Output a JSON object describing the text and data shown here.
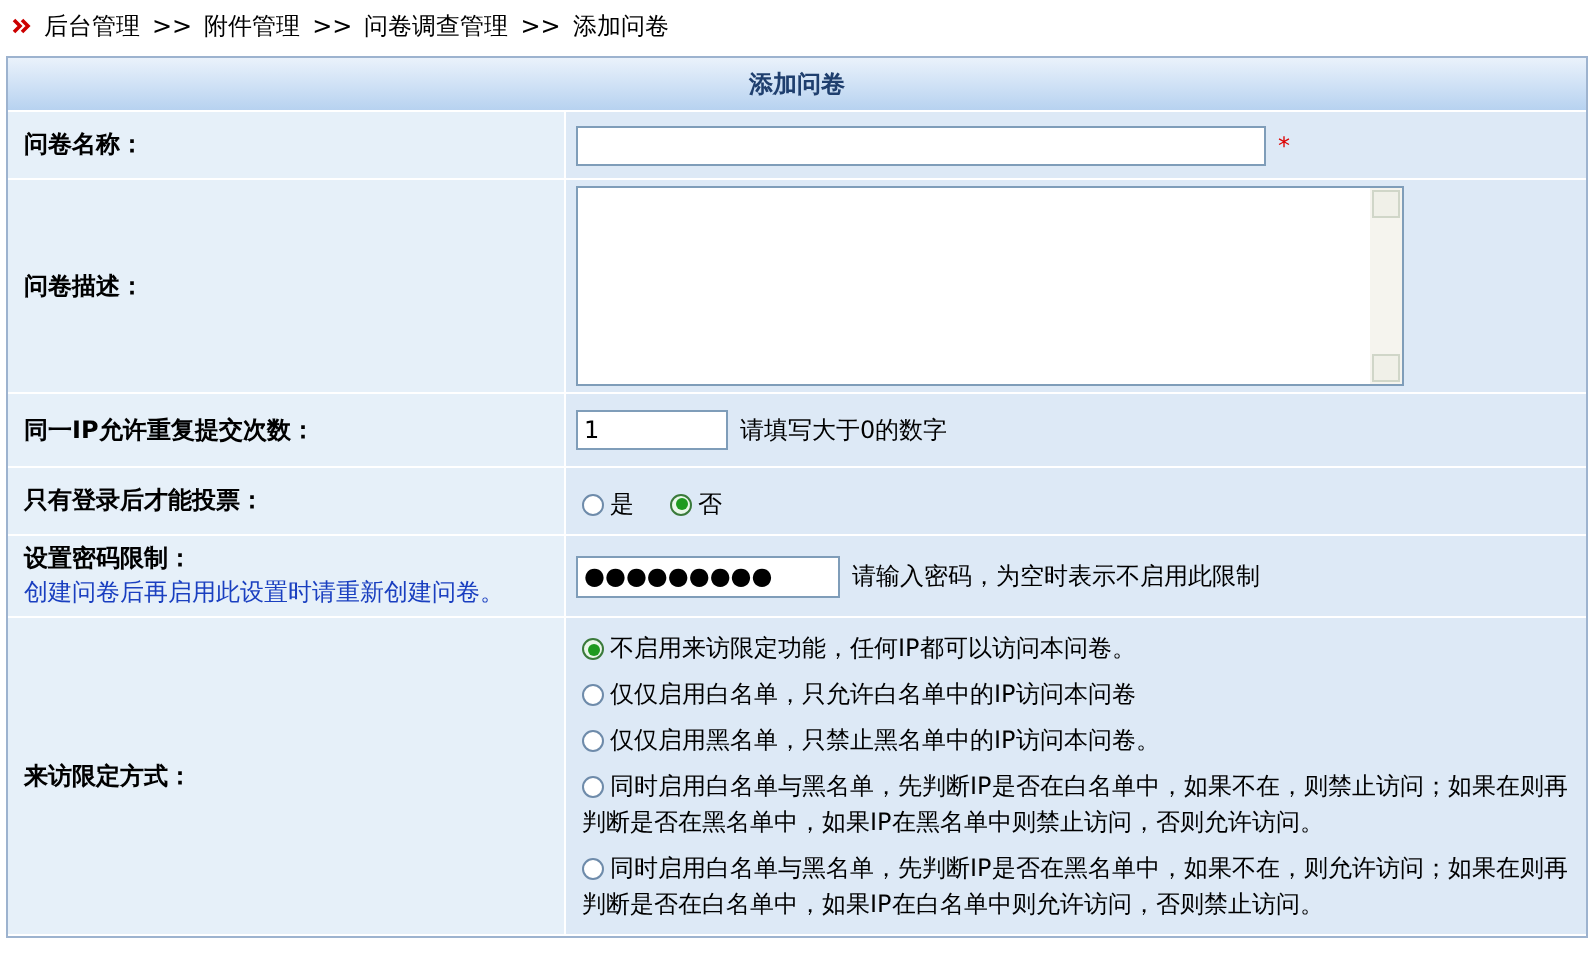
{
  "breadcrumb": {
    "items": [
      "后台管理",
      "附件管理",
      "问卷调查管理",
      "添加问卷"
    ],
    "separator": ">>"
  },
  "form": {
    "title": "添加问卷",
    "rows": [
      {
        "kind": "text",
        "label": "问卷名称：",
        "value": "",
        "required_mark": "*"
      },
      {
        "kind": "textarea",
        "label": "问卷描述：",
        "value": ""
      },
      {
        "kind": "text_hint",
        "label": "同一IP允许重复提交次数：",
        "value": "1",
        "hint": "请填写大于0的数字"
      },
      {
        "kind": "radio_inline",
        "label": "只有登录后才能投票：",
        "options": [
          {
            "label": "是",
            "selected": false
          },
          {
            "label": "否",
            "selected": true
          }
        ]
      },
      {
        "kind": "password",
        "label": "设置密码限制：",
        "note": "创建问卷后再启用此设置时请重新创建问卷。",
        "value": "●●●●●●●●●",
        "hint": "请输入密码，为空时表示不启用此限制"
      },
      {
        "kind": "radio_list",
        "label": "来访限定方式：",
        "options": [
          {
            "label": "不启用来访限定功能，任何IP都可以访问本问卷。",
            "selected": true
          },
          {
            "label": "仅仅启用白名单，只允许白名单中的IP访问本问卷",
            "selected": false
          },
          {
            "label": "仅仅启用黑名单，只禁止黑名单中的IP访问本问卷。",
            "selected": false
          },
          {
            "label": "同时启用白名单与黑名单，先判断IP是否在白名单中，如果不在，则禁止访问；如果在则再判断是否在黑名单中，如果IP在黑名单中则禁止访问，否则允许访问。",
            "selected": false
          },
          {
            "label": "同时启用白名单与黑名单，先判断IP是否在黑名单中，如果不在，则允许访问；如果在则再判断是否在白名单中，如果IP在白名单中则允许访问，否则禁止访问。",
            "selected": false
          }
        ]
      }
    ]
  }
}
